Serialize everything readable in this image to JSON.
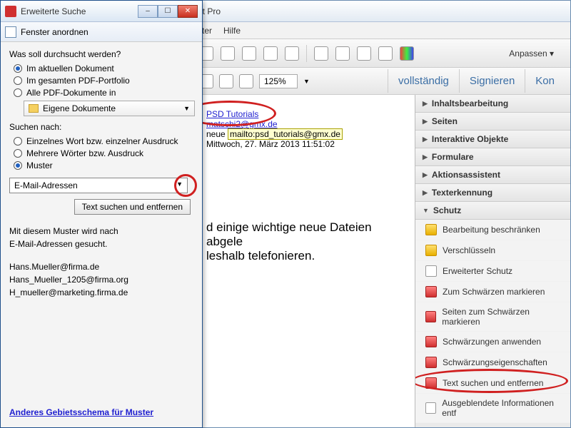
{
  "main": {
    "title_fragment": "at Pro",
    "menu": [
      "ster",
      "Hilfe"
    ],
    "toolbar2": {
      "zoom": "125%"
    },
    "tabs": [
      "vollständig",
      "Signieren",
      "Kon"
    ],
    "customize": "Anpassen  ▾"
  },
  "doc": {
    "link1": "PSD Tutorials",
    "email1": "matschi2@gmx.de",
    "neue": "neue",
    "mailto": "mailto:psd_tutorials@gmx.de",
    "date": "Mittwoch, 27. März 2013 11:51:02",
    "body1": "d einige wichtige neue Dateien abgele",
    "body2": "leshalb telefonieren."
  },
  "panel": {
    "sections": [
      "Inhaltsbearbeitung",
      "Seiten",
      "Interaktive Objekte",
      "Formulare",
      "Aktionsassistent",
      "Texterkennung",
      "Schutz"
    ],
    "schutz_items": [
      "Bearbeitung beschränken",
      "Verschlüsseln",
      "Erweiterter Schutz",
      "Zum Schwärzen markieren",
      "Seiten zum Schwärzen markieren",
      "Schwärzungen anwenden",
      "Schwärzungseigenschaften",
      "Text suchen und entfernen",
      "Ausgeblendete Informationen entf"
    ]
  },
  "search": {
    "title": "Erweiterte Suche",
    "arrange": "Fenster anordnen",
    "q1": "Was soll durchsucht werden?",
    "opt1": "Im aktuellen Dokument",
    "opt2": "Im gesamten PDF-Portfolio",
    "opt3": "Alle PDF-Dokumente in",
    "folder": "Eigene Dokumente",
    "q2": "Suchen nach:",
    "opt4": "Einzelnes Wort bzw. einzelner Ausdruck",
    "opt5": "Mehrere Wörter bzw. Ausdruck",
    "opt6": "Muster",
    "pattern": "E-Mail-Adressen",
    "button": "Text suchen und entfernen",
    "desc1": "Mit diesem Muster wird nach",
    "desc2": "E-Mail-Adressen gesucht.",
    "ex1": "Hans.Mueller@firma.de",
    "ex2": "Hans_Mueller_1205@firma.org",
    "ex3": "H_mueller@marketing.firma.de",
    "locale": "Anderes Gebietsschema für Muster "
  }
}
